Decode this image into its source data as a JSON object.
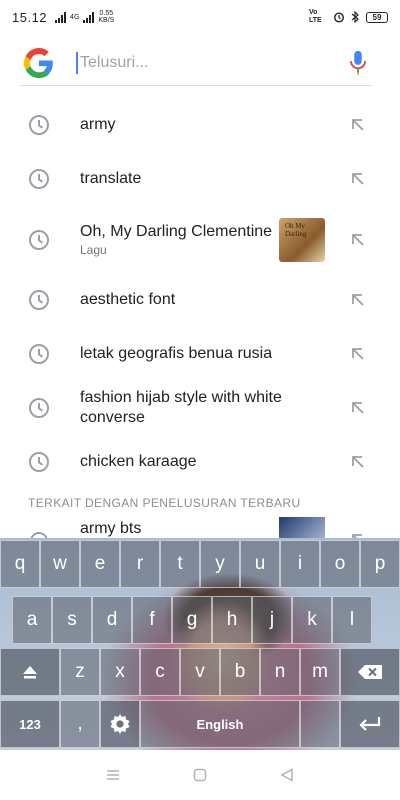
{
  "status_bar": {
    "time": "15.12",
    "net_type_1": "4G",
    "net_speed": "0.55",
    "net_unit": "KB/S",
    "volte": "Vo LTE",
    "battery": "59"
  },
  "search": {
    "placeholder": "Telusuri..."
  },
  "history": [
    {
      "label": "army"
    },
    {
      "label": "translate"
    },
    {
      "label": "Oh, My Darling Clementine",
      "sub": "Lagu",
      "thumb_text": "Oh My Darling"
    },
    {
      "label": "aesthetic font"
    },
    {
      "label": "letak geografis benua rusia"
    },
    {
      "label": "fashion hijab style with white converse"
    },
    {
      "label": "chicken karaage"
    }
  ],
  "related": {
    "section_label": "TERKAIT DENGAN PENELUSURAN TERBARU",
    "items": [
      {
        "label": "army bts"
      }
    ]
  },
  "keyboard": {
    "row1": [
      "q",
      "w",
      "e",
      "r",
      "t",
      "y",
      "u",
      "i",
      "o",
      "p"
    ],
    "row2": [
      "a",
      "s",
      "d",
      "f",
      "g",
      "h",
      "j",
      "k",
      "l"
    ],
    "row3": [
      "z",
      "x",
      "c",
      "v",
      "b",
      "n",
      "m"
    ],
    "num_key": "123",
    "comma_key": ",",
    "space_key": "English",
    "icons": {
      "shift": "shift-icon",
      "backspace": "backspace-icon",
      "settings": "gear-icon",
      "enter": "enter-icon"
    }
  },
  "colors": {
    "accent": "#4285f4",
    "icon_gray": "#9aa0a6",
    "text": "#202124"
  }
}
